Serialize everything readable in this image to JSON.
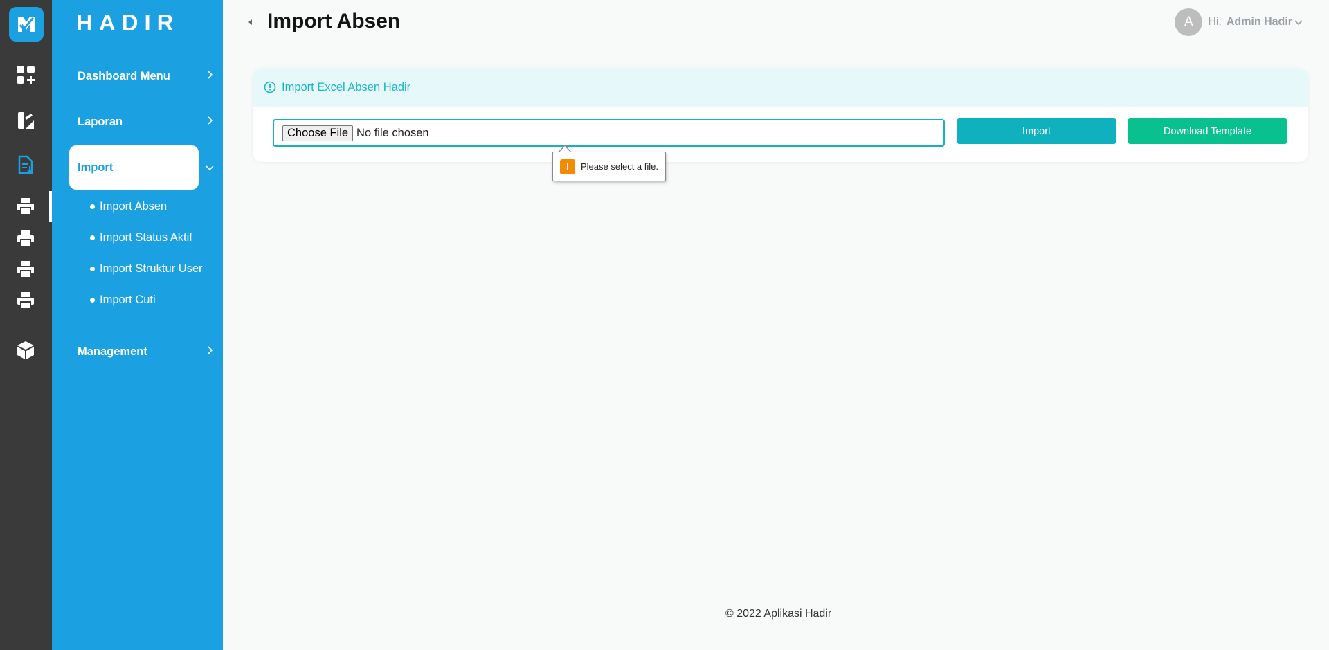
{
  "sidebar": {
    "brand": "HADIR",
    "menu": [
      {
        "label": "Dashboard Menu"
      },
      {
        "label": "Laporan"
      },
      {
        "label": "Import"
      },
      {
        "label": "Management"
      }
    ],
    "import_submenu": [
      {
        "label": "Import Absen"
      },
      {
        "label": "Import Status Aktif"
      },
      {
        "label": "Import Struktur User"
      },
      {
        "label": "Import Cuti"
      }
    ]
  },
  "rail_icons": [
    "logo-icon",
    "dashboard-add-icon",
    "report-icon",
    "import-doc-icon",
    "printer-icon",
    "printer-icon",
    "printer-icon",
    "printer-icon",
    "cube-icon"
  ],
  "header": {
    "title": "Import Absen",
    "greeting": "Hi,",
    "user_name": "Admin Hadir",
    "avatar_initial": "A"
  },
  "card": {
    "header_text": "Import Excel Absen Hadir",
    "choose_file_label": "Choose File",
    "file_status": "No file chosen",
    "import_button": "Import",
    "download_button": "Download Template"
  },
  "validation": {
    "message": "Please select a file.",
    "icon": "!"
  },
  "footer": {
    "text": "© 2022 Aplikasi Hadir"
  },
  "colors": {
    "rail": "#3a3a3a",
    "sidebar": "#1ba0e2",
    "accent_teal": "#0fb1bf",
    "accent_green": "#08c18e",
    "warning": "#f28b00"
  }
}
